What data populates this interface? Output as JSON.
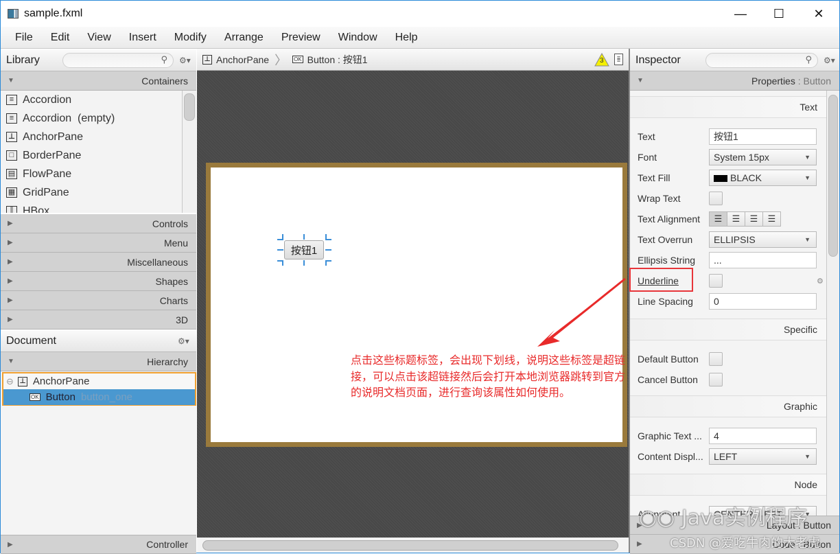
{
  "window": {
    "title": "sample.fxml",
    "controls": {
      "minimize": "—",
      "maximize": "☐",
      "close": "✕"
    }
  },
  "menu": [
    "File",
    "Edit",
    "View",
    "Insert",
    "Modify",
    "Arrange",
    "Preview",
    "Window",
    "Help"
  ],
  "library": {
    "title": "Library",
    "search_placeholder": "",
    "sections": {
      "containers": "Containers",
      "collapsed": [
        "Controls",
        "Menu",
        "Miscellaneous",
        "Shapes",
        "Charts",
        "3D"
      ]
    },
    "items": [
      {
        "label": "Accordion",
        "icon": "accordion-icon"
      },
      {
        "label": "Accordion  (empty)",
        "icon": "accordion-icon"
      },
      {
        "label": "AnchorPane",
        "icon": "anchor-icon"
      },
      {
        "label": "BorderPane",
        "icon": "borderpane-icon"
      },
      {
        "label": "FlowPane",
        "icon": "flowpane-icon"
      },
      {
        "label": "GridPane",
        "icon": "grid-icon"
      },
      {
        "label": "HBox",
        "icon": "hbox-icon"
      }
    ]
  },
  "document": {
    "title": "Document",
    "hierarchy_label": "Hierarchy",
    "tree": {
      "root": "AnchorPane",
      "child_type": "Button",
      "child_id": "button_one"
    },
    "controller_label": "Controller"
  },
  "breadcrumb": {
    "root": "AnchorPane",
    "current": "Button : 按钮1",
    "warning_count": "3"
  },
  "canvas": {
    "button_text": "按钮1",
    "annotation": "点击这些标题标签，会出现下划线，说明这些标签是超链接，可以点击该超链接然后会打开本地浏览器跳转到官方的说明文档页面，进行查询该属性如何使用。",
    "annotation_color": "#e82a2a"
  },
  "inspector": {
    "title": "Inspector",
    "properties_label": "Properties",
    "properties_target": "Button",
    "sections": {
      "text": "Text",
      "specific": "Specific",
      "graphic": "Graphic",
      "node": "Node"
    },
    "props": {
      "text": {
        "label": "Text",
        "value": "按钮1"
      },
      "font": {
        "label": "Font",
        "value": "System 15px"
      },
      "text_fill": {
        "label": "Text Fill",
        "value": "BLACK"
      },
      "wrap_text": {
        "label": "Wrap Text",
        "checked": false
      },
      "text_alignment": {
        "label": "Text Alignment",
        "selected": "left"
      },
      "text_overrun": {
        "label": "Text Overrun",
        "value": "ELLIPSIS"
      },
      "ellipsis_string": {
        "label": "Ellipsis String",
        "value": "..."
      },
      "underline": {
        "label": "Underline",
        "checked": false
      },
      "line_spacing": {
        "label": "Line Spacing",
        "value": "0"
      },
      "default_button": {
        "label": "Default Button",
        "checked": false
      },
      "cancel_button": {
        "label": "Cancel Button",
        "checked": false
      },
      "graphic_text_gap": {
        "label": "Graphic Text ...",
        "value": "4"
      },
      "content_display": {
        "label": "Content Displ...",
        "value": "LEFT"
      },
      "alignment": {
        "label": "Alignment",
        "value": "CENTER_LEFT"
      }
    },
    "layout_label": "Layout : Button",
    "code_label": "Code : Button"
  },
  "watermark": {
    "line1": "Java实例程序",
    "line2": "CSDN @爱吃牛肉的大老虎"
  }
}
